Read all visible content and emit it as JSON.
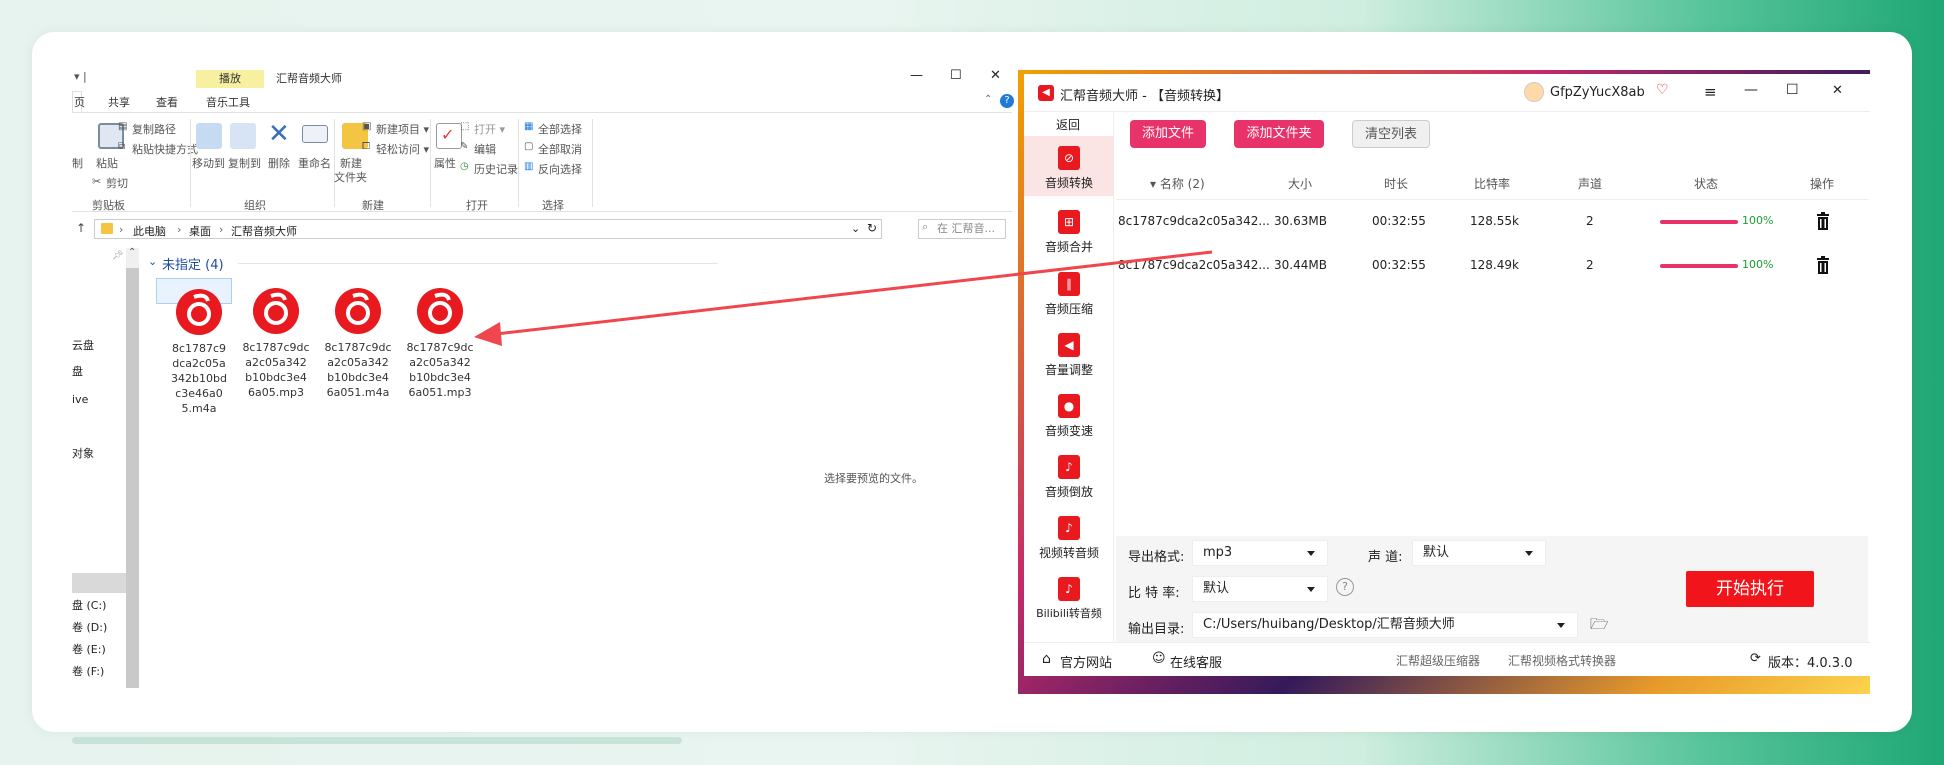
{
  "explorer": {
    "title": "汇帮音频大师",
    "qa_arrow": "▾ |",
    "context_tab": "播放",
    "tabs": [
      "页",
      "共享",
      "查看",
      "音乐工具"
    ],
    "window_controls": {
      "min": "—",
      "max": "☐",
      "close": "✕"
    },
    "ribbon": {
      "cut_partial": "制",
      "paste": "粘贴",
      "copy_path": "复制路径",
      "paste_shortcut": "粘贴快捷方式",
      "cut": "剪切",
      "move_to": "移动到",
      "copy_to": "复制到",
      "delete": "删除",
      "rename": "重命名",
      "new_folder_1": "新建",
      "new_folder_2": "文件夹",
      "new_item": "新建项目 ▾",
      "easy_access": "轻松访问 ▾",
      "properties": "属性",
      "open": "打开 ▾",
      "edit": "编辑",
      "history": "历史记录",
      "select_all": "全部选择",
      "select_none": "全部取消",
      "invert": "反向选择",
      "groups": [
        "剪贴板",
        "组织",
        "新建",
        "打开",
        "选择"
      ]
    },
    "address": {
      "parts": [
        "此电脑",
        "桌面",
        "汇帮音频大师"
      ],
      "sep": "›"
    },
    "search_placeholder": "在 汇帮音...",
    "nav": [
      "云盘",
      "盘",
      "ive",
      "对象",
      "盘 (C:)",
      "卷 (D:)",
      "卷 (E:)",
      "卷 (F:)"
    ],
    "group_header": "未指定 (4)",
    "files": [
      {
        "name": "8c1787c9dca2c05a342b10bdc3e46a05.m4a"
      },
      {
        "name": "8c1787c9dca2c05a342b10bdc3e46a05.mp3"
      },
      {
        "name": "8c1787c9dca2c05a342b10bdc3e46a051.m4a"
      },
      {
        "name": "8c1787c9dca2c05a342b10bdc3e46a051.mp3"
      }
    ],
    "preview_text": "选择要预览的文件。"
  },
  "app": {
    "title": "汇帮音频大师 - 【音频转换】",
    "user": "GfpZyYucX8ab",
    "back": "返回",
    "sidebar": [
      {
        "label": "音频转换",
        "icon": "⊘"
      },
      {
        "label": "音频合并",
        "icon": "⊞"
      },
      {
        "label": "音频压缩",
        "icon": "∥"
      },
      {
        "label": "音量调整",
        "icon": "◀"
      },
      {
        "label": "音频变速",
        "icon": "●"
      },
      {
        "label": "音频倒放",
        "icon": "♪"
      },
      {
        "label": "视频转音频",
        "icon": "♪"
      },
      {
        "label": "Bilibili转音频",
        "icon": "♪"
      }
    ],
    "buttons": {
      "add_file": "添加文件",
      "add_folder": "添加文件夹",
      "clear": "清空列表"
    },
    "columns": [
      "▾ 名称 (2)",
      "大小",
      "时长",
      "比特率",
      "声道",
      "状态",
      "操作"
    ],
    "rows": [
      {
        "name": "8c1787c9dca2c05a342...",
        "size": "30.63MB",
        "duration": "00:32:55",
        "bitrate": "128.55k",
        "channels": "2",
        "progress": 100,
        "pct": "100%"
      },
      {
        "name": "8c1787c9dca2c05a342...",
        "size": "30.44MB",
        "duration": "00:32:55",
        "bitrate": "128.49k",
        "channels": "2",
        "progress": 100,
        "pct": "100%"
      }
    ],
    "settings": {
      "format_label": "导出格式:",
      "format_value": "mp3",
      "channel_label": "声 道:",
      "channel_value": "默认",
      "bitrate_label": "比 特 率:",
      "bitrate_value": "默认",
      "output_label": "输出目录:",
      "output_value": "C:/Users/huibang/Desktop/汇帮音频大师"
    },
    "start": "开始执行",
    "footer": {
      "website": "官方网站",
      "support": "在线客服",
      "link1": "汇帮超级压缩器",
      "link2": "汇帮视频格式转换器",
      "version": "版本：4.0.3.0"
    }
  },
  "colors": {
    "accent": "#e8336a",
    "red": "#e8191f",
    "start": "#f2141b",
    "progress_text": "#1a9e33",
    "arrow": "#f0464e"
  }
}
